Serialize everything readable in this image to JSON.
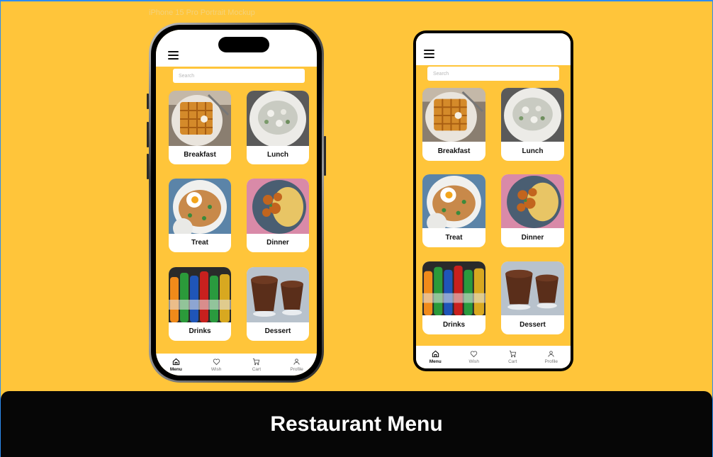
{
  "mockup_label": "iPhone 15 Pro Portrait Mockup",
  "search_placeholder": "Search",
  "categories": [
    {
      "label": "Breakfast",
      "image": "waffle-plate"
    },
    {
      "label": "Lunch",
      "image": "rice-stew-plate"
    },
    {
      "label": "Treat",
      "image": "fried-rice-egg-plate"
    },
    {
      "label": "Dinner",
      "image": "noodles-chicken-plate"
    },
    {
      "label": "Drinks",
      "image": "soda-bottles"
    },
    {
      "label": "Dessert",
      "image": "chocolate-pudding-cups"
    }
  ],
  "nav": [
    {
      "label": "Menu",
      "icon": "home-icon",
      "active": true
    },
    {
      "label": "Wish",
      "icon": "heart-icon",
      "active": false
    },
    {
      "label": "Cart",
      "icon": "cart-icon",
      "active": false
    },
    {
      "label": "Profile",
      "icon": "user-icon",
      "active": false
    }
  ],
  "banner_title": "Restaurant Menu",
  "colors": {
    "background": "#FFC53A",
    "banner": "#060606",
    "card": "#FFFFFF"
  }
}
